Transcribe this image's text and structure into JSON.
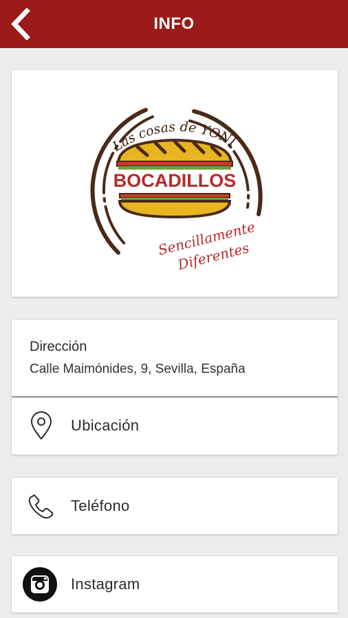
{
  "header": {
    "title": "INFO",
    "back_icon": "chevron-left-icon",
    "background": "#9c1a1a"
  },
  "logo": {
    "line1": "Las cosas de YONI",
    "line2": "BOCADILLOS",
    "line3a": "Sencillamente",
    "line3b": "Diferentes"
  },
  "address": {
    "label": "Dirección",
    "value": "Calle Maimónides, 9, Sevilla, España"
  },
  "location": {
    "label": "Ubicación",
    "icon": "map-pin-icon"
  },
  "phone": {
    "label": "Teléfono",
    "icon": "phone-icon"
  },
  "instagram": {
    "label": "Instagram",
    "icon": "instagram-icon"
  }
}
